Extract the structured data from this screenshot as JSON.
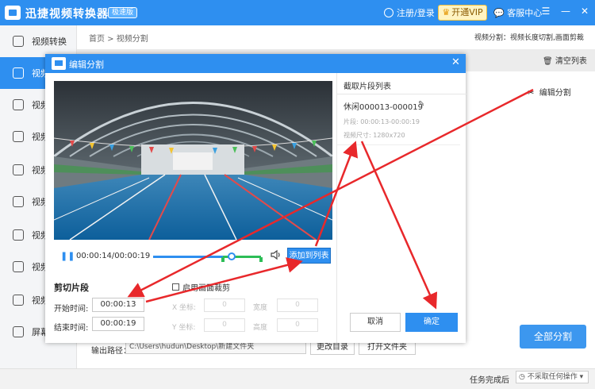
{
  "app": {
    "title": "迅捷视频转换器",
    "badge": "极速版",
    "login": "注册/登录",
    "vip": "开通VIP",
    "service": "客服中心"
  },
  "sidebar": {
    "items": [
      {
        "label": "视频转换",
        "icon": "video-convert-icon"
      },
      {
        "label": "视频",
        "icon": "video-split-icon"
      },
      {
        "label": "视频",
        "icon": "video-merge-icon"
      },
      {
        "label": "视频",
        "icon": "gif-icon"
      },
      {
        "label": "视频",
        "icon": "audio-extract-icon"
      },
      {
        "label": "视频",
        "icon": "video-compress-icon"
      },
      {
        "label": "视频",
        "icon": "watermark-icon"
      },
      {
        "label": "视频",
        "icon": "video-edit-icon"
      },
      {
        "label": "视频",
        "icon": "speed-icon"
      },
      {
        "label": "屏幕",
        "icon": "screen-record-icon"
      }
    ]
  },
  "main": {
    "breadcrumb": "首页 > 视频分割",
    "mode_info": "视频分割：视频长度切割,画面剪裁",
    "clear_list": "清空列表",
    "edit_split": "编辑分割",
    "all_split": "全部分割",
    "output_label": "输出路径：",
    "output_path": "C:\\Users\\hudun\\Desktop\\新建文件夹",
    "change_dir": "更改目录",
    "open_folder": "打开文件夹",
    "status_text": "任务完成后",
    "status_option": "不采取任何操作"
  },
  "dialog": {
    "title": "编辑分割",
    "time_display": "00:00:14/00:00:19",
    "add_to_list": "添加到列表",
    "cut_section": "剪切片段",
    "start_label": "开始时间:",
    "start_value": "00:00:13",
    "end_label": "结束时间:",
    "end_value": "00:00:19",
    "crop_label": "启用画面裁剪",
    "x_label": "X 坐标:",
    "y_label": "Y 坐标:",
    "width_label": "宽度",
    "height_label": "高度",
    "x_value": "0",
    "y_value": "0",
    "width_value": "0",
    "height_value": "0",
    "list_title": "截取片段列表",
    "clip_name": "休闲000013-000019",
    "clip_range": "片段:     00:00:13-00:00:19",
    "clip_size": "视频尺寸:  1280x720",
    "cancel": "取消",
    "ok": "确定",
    "timeline_progress": 0.72
  },
  "colors": {
    "accent": "#2e8ff0",
    "annotation_arrow": "#e8282b",
    "marker_green": "#2dbd57"
  }
}
